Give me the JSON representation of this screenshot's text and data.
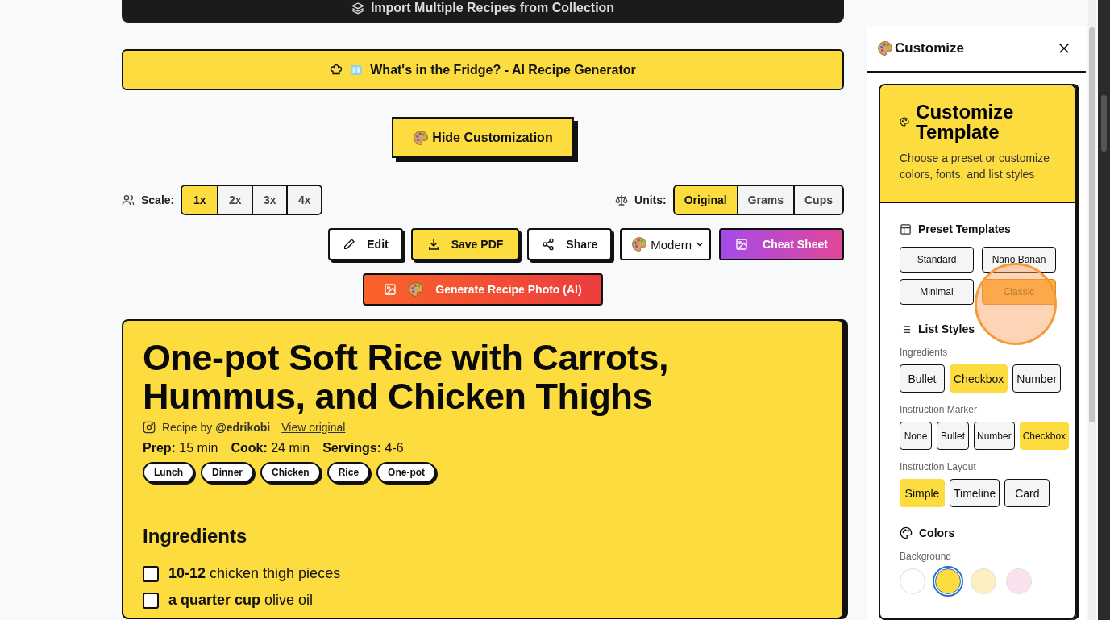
{
  "import_button": {
    "label": "Import Multiple Recipes from Collection"
  },
  "fridge_button": {
    "label": "What's in the Fridge? - AI Recipe Generator"
  },
  "toggle_button": {
    "label": "Hide Customization"
  },
  "scale": {
    "label": "Scale:",
    "options": [
      {
        "label": "1x",
        "selected": true
      },
      {
        "label": "2x",
        "selected": false
      },
      {
        "label": "3x",
        "selected": false
      },
      {
        "label": "4x",
        "selected": false
      }
    ]
  },
  "units": {
    "label": "Units:",
    "options": [
      {
        "label": "Original",
        "selected": true
      },
      {
        "label": "Grams",
        "selected": false
      },
      {
        "label": "Cups",
        "selected": false
      }
    ]
  },
  "actions": [
    {
      "kind": "edit",
      "label": "Edit"
    },
    {
      "kind": "pdf",
      "label": "Save PDF"
    },
    {
      "kind": "share",
      "label": "Share"
    },
    {
      "kind": "select",
      "label": "Modern"
    },
    {
      "kind": "cheat",
      "label": "Cheat Sheet"
    }
  ],
  "photo_button": {
    "label": "Generate Recipe Photo (AI)"
  },
  "recipe": {
    "title": "One-pot Soft Rice with Carrots, Hummus, and Chicken Thighs",
    "credit": "Recipe by **@edrikobi**",
    "link": "View original",
    "meta": [
      {
        "label": "Prep:",
        "value": "15 min"
      },
      {
        "label": "Cook:",
        "value": "24 min"
      },
      {
        "label": "Servings:",
        "value": "4-6"
      }
    ],
    "tags": [
      "Lunch",
      "Dinner",
      "Chicken",
      "Rice",
      "One-pot"
    ],
    "ingredients_title": "Ingredients",
    "ingredients": [
      {
        "text": "**10-12** chicken thigh pieces",
        "checked": false
      },
      {
        "text": "**a quarter cup** olive oil",
        "checked": false
      }
    ]
  },
  "panel": {
    "title": "Customize",
    "card_title": "Customize Template",
    "card_text": "Choose a preset or customize colors, fonts, and list styles",
    "presets_title": "Preset Templates",
    "presets": [
      {
        "label": "Standard",
        "selected": false
      },
      {
        "label": "Nano Banan",
        "selected": false
      },
      {
        "label": "Minimal",
        "selected": false
      },
      {
        "label": "Classic",
        "selected": true
      }
    ],
    "list_styles_title": "List Styles",
    "groups": [
      {
        "label": "Ingredients",
        "options": [
          {
            "label": "Bullet",
            "selected": false
          },
          {
            "label": "Checkbox",
            "selected": true
          },
          {
            "label": "Number",
            "selected": false
          }
        ]
      },
      {
        "label": "Instruction Marker",
        "options": [
          {
            "label": "None",
            "selected": false
          },
          {
            "label": "Bullet",
            "selected": false
          },
          {
            "label": "Number",
            "selected": false
          },
          {
            "label": "Checkbox",
            "selected": true
          }
        ]
      },
      {
        "label": "Instruction Layout",
        "options": [
          {
            "label": "Simple",
            "selected": true
          },
          {
            "label": "Timeline",
            "selected": false
          },
          {
            "label": "Card",
            "selected": false
          }
        ]
      }
    ],
    "colors_title": "Colors",
    "background_label": "Background",
    "swatches": [
      {
        "color": "#ffffff",
        "selected": false
      },
      {
        "color": "#fddc3f",
        "selected": true
      },
      {
        "color": "#fdf0c0",
        "selected": false
      },
      {
        "color": "#fbe0ef",
        "selected": false
      }
    ]
  }
}
